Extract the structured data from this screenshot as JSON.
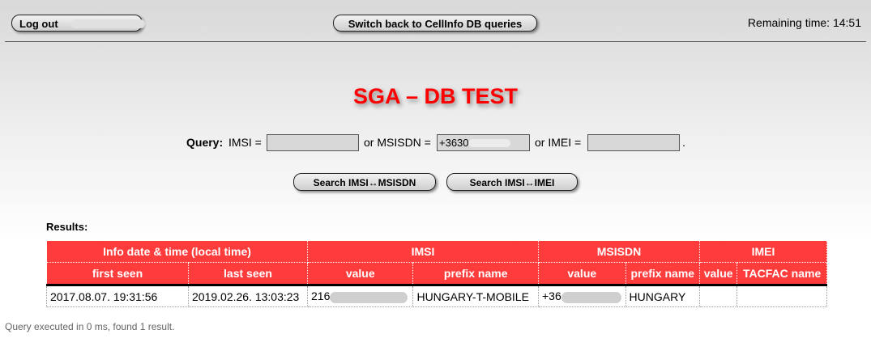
{
  "header": {
    "logout_label": "Log out",
    "switch_label": "Switch back to CellInfo DB queries",
    "remaining_label": "Remaining time: 14:51"
  },
  "title": "SGA – DB TEST",
  "query": {
    "label": "Query:",
    "imsi_label": "IMSI =",
    "or_msisdn_label": "or MSISDN =",
    "or_imei_label": "or IMEI =",
    "imsi_value": "",
    "msisdn_value": "+3630",
    "imei_value": "",
    "trailing": "."
  },
  "buttons": {
    "search_imsi_msisdn": "Search IMSI↔MSISDN",
    "search_imsi_imei": "Search IMSI↔IMEI"
  },
  "results": {
    "label": "Results:",
    "group_headers": [
      "Info date & time  (local time)",
      "IMSI",
      "MSISDN",
      "IMEI"
    ],
    "sub_headers": [
      "first seen",
      "last seen",
      "value",
      "prefix name",
      "value",
      "prefix name",
      "value",
      "TACFAC name"
    ],
    "rows": [
      {
        "first_seen": "2017.08.07. 19:31:56",
        "last_seen": "2019.02.26. 13:03:23",
        "imsi_value": "216",
        "imsi_prefix": "HUNGARY-T-MOBILE",
        "msisdn_value": "+36",
        "msisdn_prefix": "HUNGARY",
        "imei_value": "",
        "tacfac_name": ""
      }
    ]
  },
  "footer": "Query executed in 0 ms, found 1 result."
}
